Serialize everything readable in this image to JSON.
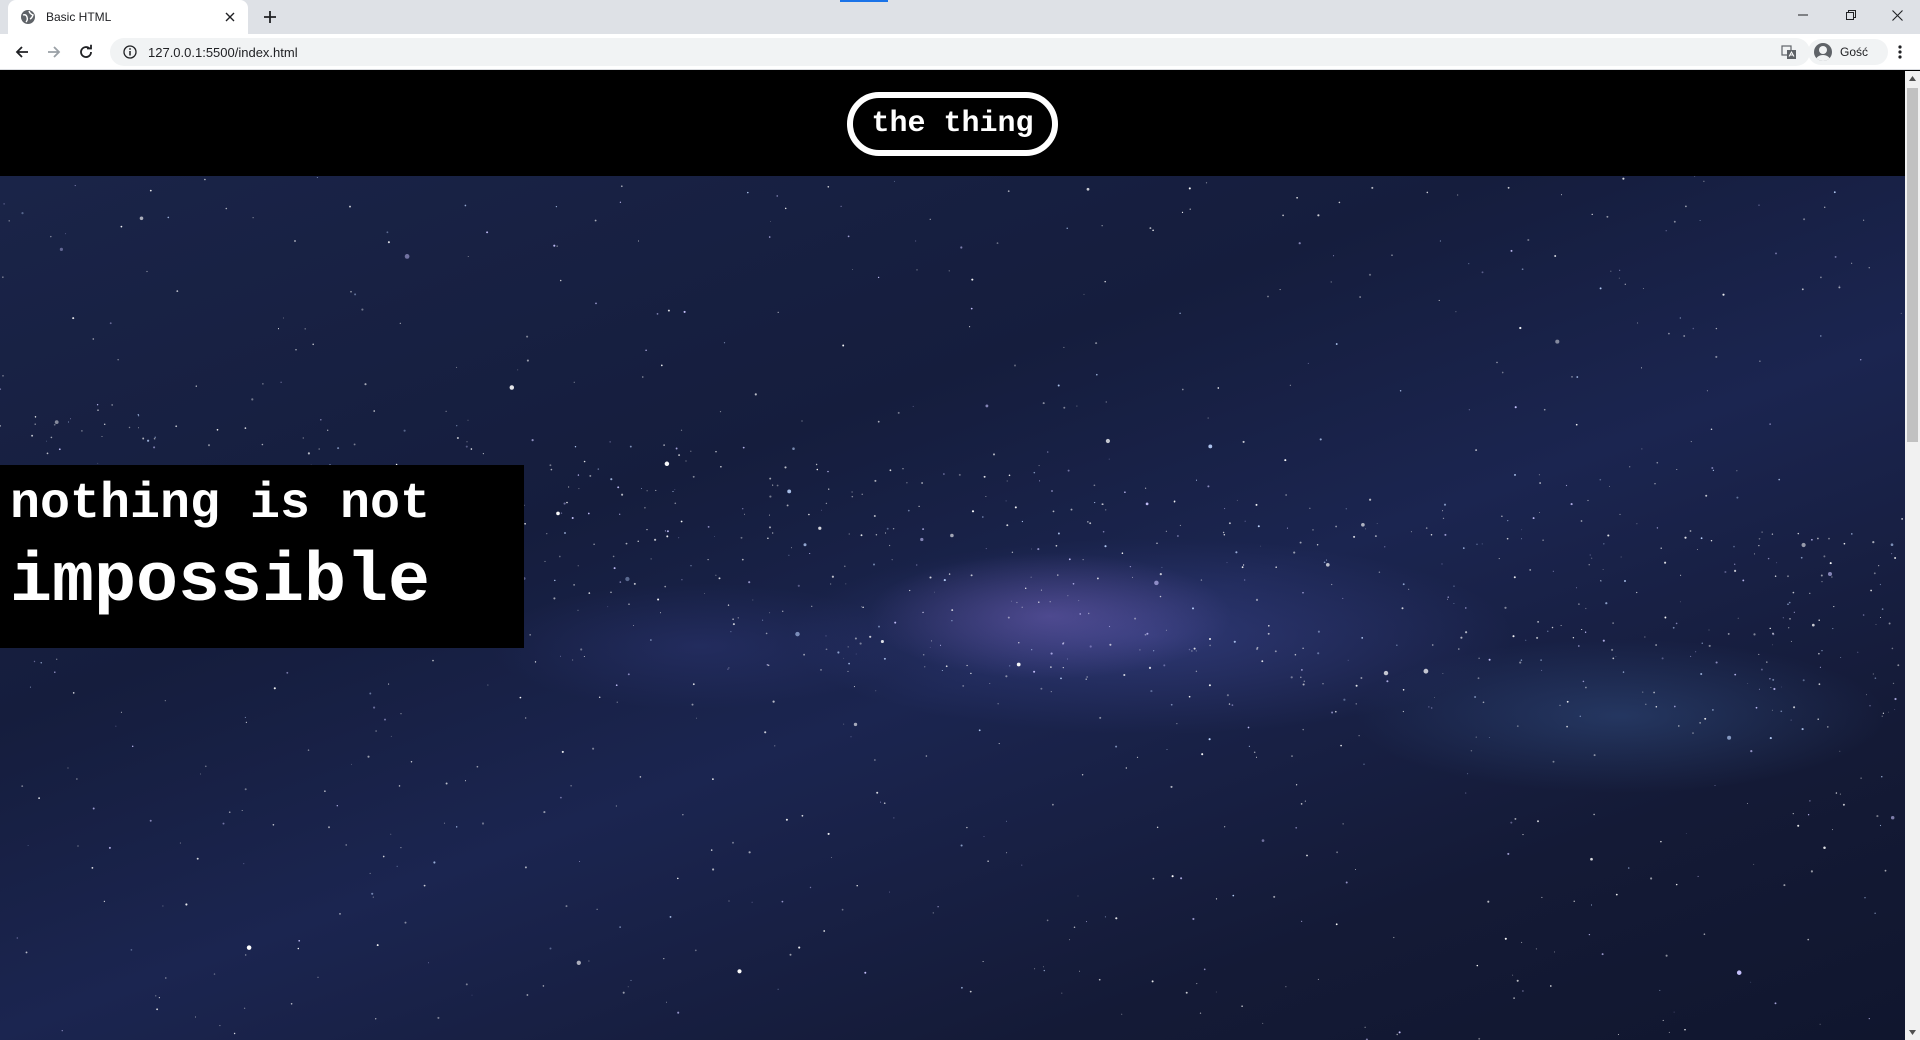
{
  "browser": {
    "tab": {
      "title": "Basic HTML",
      "favicon": "globe-icon"
    },
    "address_bar": {
      "url": "127.0.0.1:5500/index.html"
    },
    "profile": {
      "name": "Gość"
    }
  },
  "page": {
    "header": {
      "logo_text": "the thing"
    },
    "hero": {
      "tagline_line1": "nothing is not",
      "tagline_line2": "impossible",
      "background": "starry-night-milky-way-image"
    }
  },
  "colors": {
    "header_bg": "#000000",
    "text": "#ffffff",
    "tab_active_indicator": "#1a73e8"
  }
}
